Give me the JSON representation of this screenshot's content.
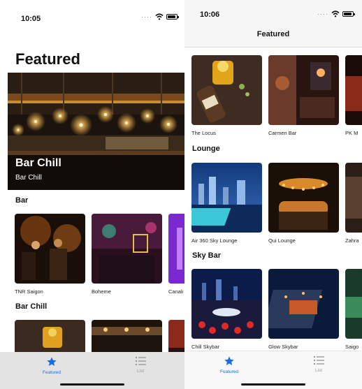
{
  "phone_a": {
    "status": {
      "time": "10:05"
    },
    "title": "Featured",
    "hero": {
      "title": "Bar Chill",
      "subtitle": "Bar Chill"
    },
    "sections": [
      {
        "header": "Bar",
        "items": [
          "TNR Saigon",
          "Boheme",
          "Canali"
        ]
      },
      {
        "header": "Bar Chill",
        "items": []
      }
    ],
    "tabs": [
      {
        "label": "Featured",
        "icon": "star-icon",
        "selected": true
      },
      {
        "label": "List",
        "icon": "list-icon",
        "selected": false
      }
    ]
  },
  "phone_b": {
    "status": {
      "time": "10:06"
    },
    "nav_title": "Featured",
    "sections": [
      {
        "header": "",
        "items": [
          "The Locus",
          "Carmen Bar",
          "PK M"
        ]
      },
      {
        "header": "Lounge",
        "items": [
          "Air 360 Sky Lounge",
          "Qui Lounge",
          "Zahra"
        ]
      },
      {
        "header": "Sky Bar",
        "items": [
          "Chill Skybar",
          "Glow Skybar",
          "Saigo"
        ]
      }
    ],
    "tabs": [
      {
        "label": "Featured",
        "icon": "star-icon",
        "selected": true
      },
      {
        "label": "List",
        "icon": "list-icon",
        "selected": false
      }
    ]
  },
  "colors": {
    "accent": "#1a6fe0",
    "inactive": "#9a9a9a"
  }
}
